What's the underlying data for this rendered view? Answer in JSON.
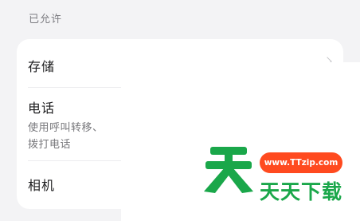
{
  "section": {
    "header": "已允许"
  },
  "permissions": [
    {
      "title": "存储"
    },
    {
      "title": "电话",
      "description_line1": "使用呼叫转移、",
      "description_line2": "拨打电话"
    },
    {
      "title": "相机"
    }
  ],
  "watermark": {
    "url": "www.TTzip.com",
    "name": "天天下载",
    "colors": {
      "green": "#1aa74a",
      "orange": "#ff4a1f"
    }
  }
}
